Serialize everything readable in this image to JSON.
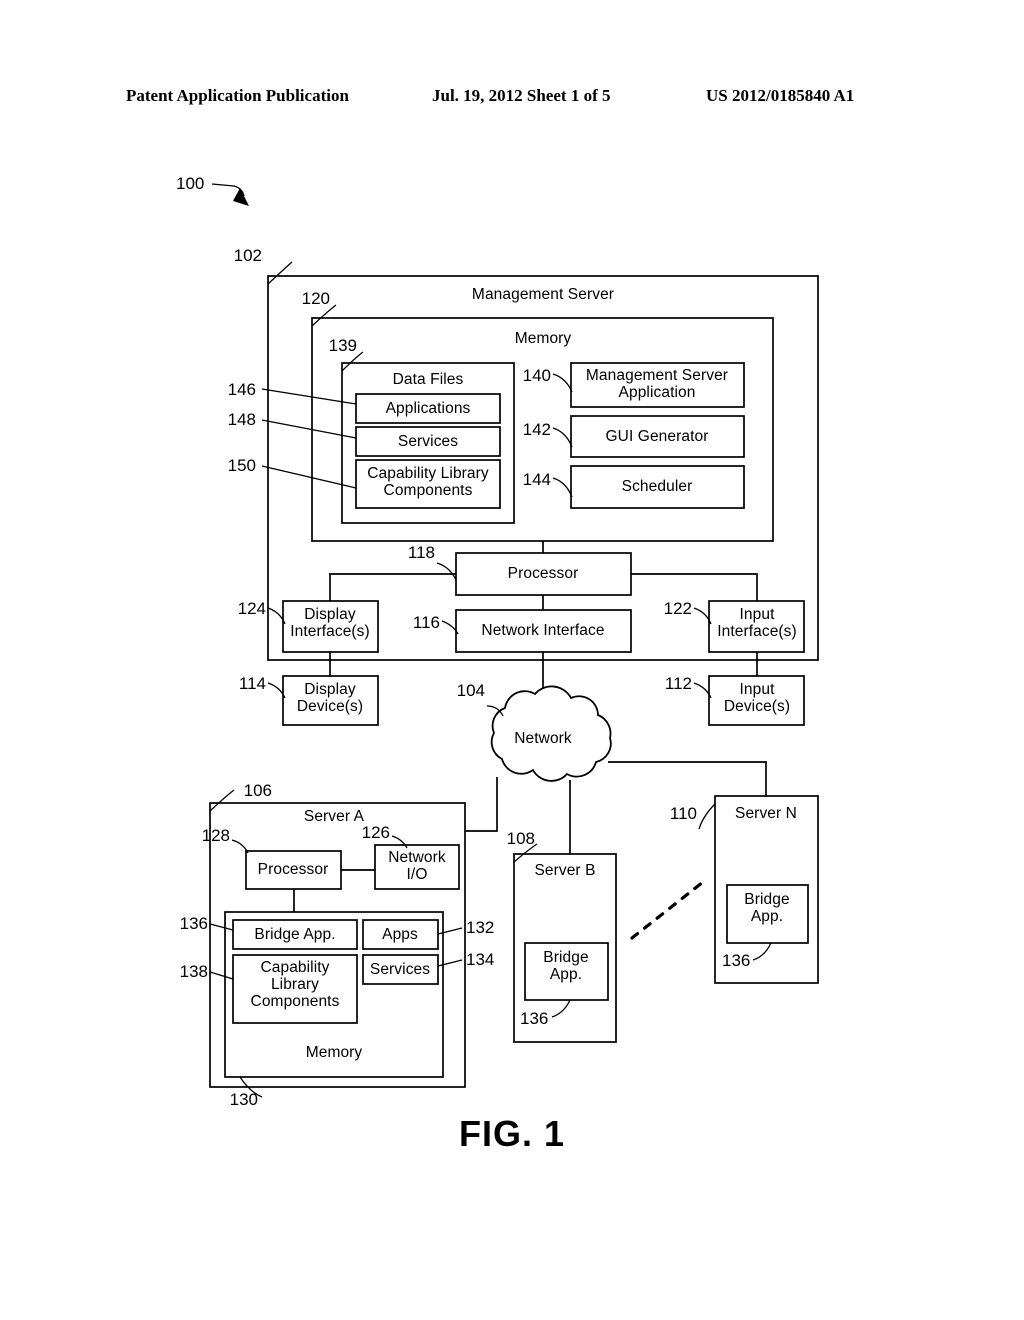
{
  "header": {
    "publication": "Patent Application Publication",
    "date_sheet": "Jul. 19, 2012   Sheet 1 of 5",
    "patent_number": "US 2012/0185840 A1"
  },
  "figure": {
    "caption": "FIG. 1",
    "system_ref": "100"
  },
  "management_server": {
    "ref": "102",
    "title": "Management Server",
    "memory": {
      "ref": "120",
      "title": "Memory",
      "data_files": {
        "ref": "139",
        "title": "Data Files",
        "items": [
          {
            "ref": "146",
            "label": "Applications"
          },
          {
            "ref": "148",
            "label": "Services"
          },
          {
            "ref": "150",
            "label": "Capability Library Components"
          }
        ]
      },
      "modules": [
        {
          "ref": "140",
          "label": "Management Server Application"
        },
        {
          "ref": "142",
          "label": "GUI Generator"
        },
        {
          "ref": "144",
          "label": "Scheduler"
        }
      ]
    },
    "processor": {
      "ref": "118",
      "label": "Processor"
    },
    "network_interface": {
      "ref": "116",
      "label": "Network Interface"
    },
    "display_interface": {
      "ref": "124",
      "label": "Display Interface(s)"
    },
    "input_interface": {
      "ref": "122",
      "label": "Input Interface(s)"
    }
  },
  "peripherals": {
    "display_device": {
      "ref": "114",
      "label": "Display Device(s)"
    },
    "input_device": {
      "ref": "112",
      "label": "Input Device(s)"
    }
  },
  "network": {
    "ref": "104",
    "label": "Network"
  },
  "server_a": {
    "ref": "106",
    "title": "Server A",
    "processor": {
      "ref": "128",
      "label": "Processor"
    },
    "network_io": {
      "ref": "126",
      "label": "Network I/O"
    },
    "memory": {
      "ref": "130",
      "title": "Memory",
      "bridge_app": {
        "ref": "136",
        "label": "Bridge App."
      },
      "capability_library": {
        "ref": "138",
        "label": "Capability Library Components"
      },
      "apps": {
        "ref": "132",
        "label": "Apps"
      },
      "services": {
        "ref": "134",
        "label": "Services"
      }
    }
  },
  "server_b": {
    "ref": "108",
    "title": "Server B",
    "bridge_app": {
      "ref": "136",
      "label": "Bridge App."
    }
  },
  "server_n": {
    "ref": "110",
    "title": "Server N",
    "bridge_app": {
      "ref": "136",
      "label": "Bridge App."
    }
  }
}
